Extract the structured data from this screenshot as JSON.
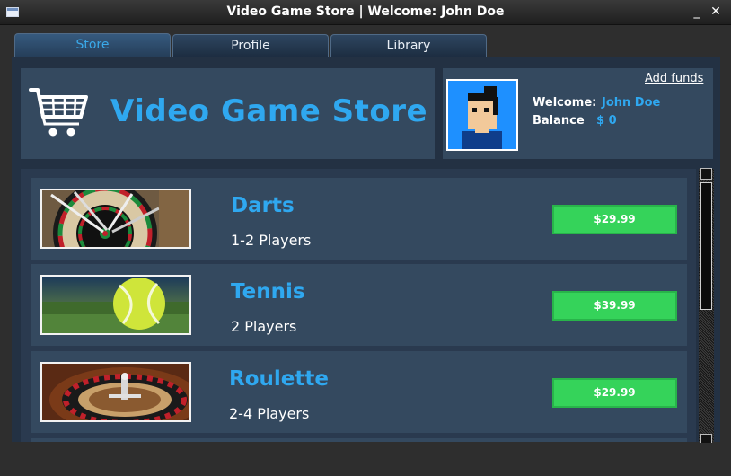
{
  "window": {
    "title": "Video Game Store | Welcome: John Doe",
    "minimize_glyph": "_",
    "close_glyph": "✕"
  },
  "tabs": [
    {
      "label": "Store",
      "active": true
    },
    {
      "label": "Profile",
      "active": false
    },
    {
      "label": "Library",
      "active": false
    }
  ],
  "store": {
    "title": "Video Game Store",
    "icon": "shopping-cart-icon"
  },
  "account": {
    "add_funds_label": "Add funds",
    "welcome_label": "Welcome:",
    "user_name": "John Doe",
    "balance_label": "Balance",
    "balance_value": "$ 0",
    "avatar": "pixel-avatar"
  },
  "games": [
    {
      "name": "Darts",
      "players": "1-2 Players",
      "price": "$29.99",
      "thumbnail": "dartboard"
    },
    {
      "name": "Tennis",
      "players": "2 Players",
      "price": "$39.99",
      "thumbnail": "tennis-ball"
    },
    {
      "name": "Roulette",
      "players": "2-4 Players",
      "price": "$29.99",
      "thumbnail": "roulette-wheel"
    }
  ],
  "colors": {
    "accent": "#2fa8f0",
    "price_button": "#35d35a",
    "panel": "#34495f",
    "list_bg": "#2a3a4f"
  }
}
